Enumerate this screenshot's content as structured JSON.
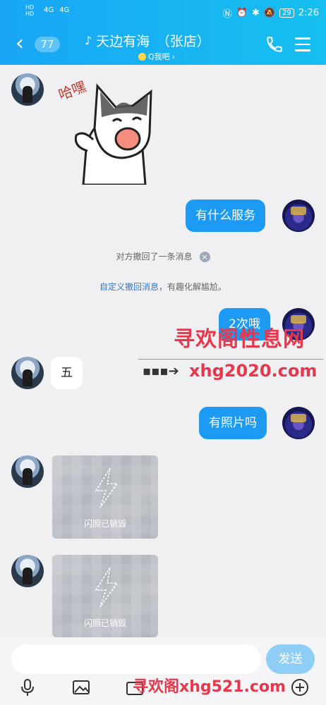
{
  "status_bar": {
    "left_top": "HD",
    "left_bottom": "HD",
    "signal_a": "4G",
    "signal_b": "4G",
    "battery": "29",
    "time": "2:26"
  },
  "header": {
    "unread": "77",
    "title": "天边有海　（张店）",
    "subtitle": "Q我吧"
  },
  "messages": {
    "m2": "有什么服务",
    "notice1": "对方撤回了一条消息",
    "notice2_link": "自定义撤回消息",
    "notice2_rest": "，有趣化解尴尬。",
    "m3": "2次哦",
    "m4": "五",
    "m5": "有照片吗",
    "flash1": "闪照已销毁",
    "flash2": "闪照已销毁"
  },
  "sticker": {
    "caption": "哈嘿"
  },
  "watermarks": {
    "site_cn": "寻欢阁性息网",
    "site_url": "xhg2020.com",
    "bottom": "寻欢阁xhg521.com"
  },
  "input": {
    "placeholder": "",
    "send_label": "发送"
  },
  "icons": {
    "back": "chevron-left-icon",
    "phone": "phone-icon",
    "menu": "menu-icon",
    "voice": "mic-icon",
    "image": "image-icon",
    "plus": "plus-icon"
  },
  "colors": {
    "accent": "#1d9bf4",
    "header": "#16c0f0",
    "watermark": "#e8374a"
  }
}
